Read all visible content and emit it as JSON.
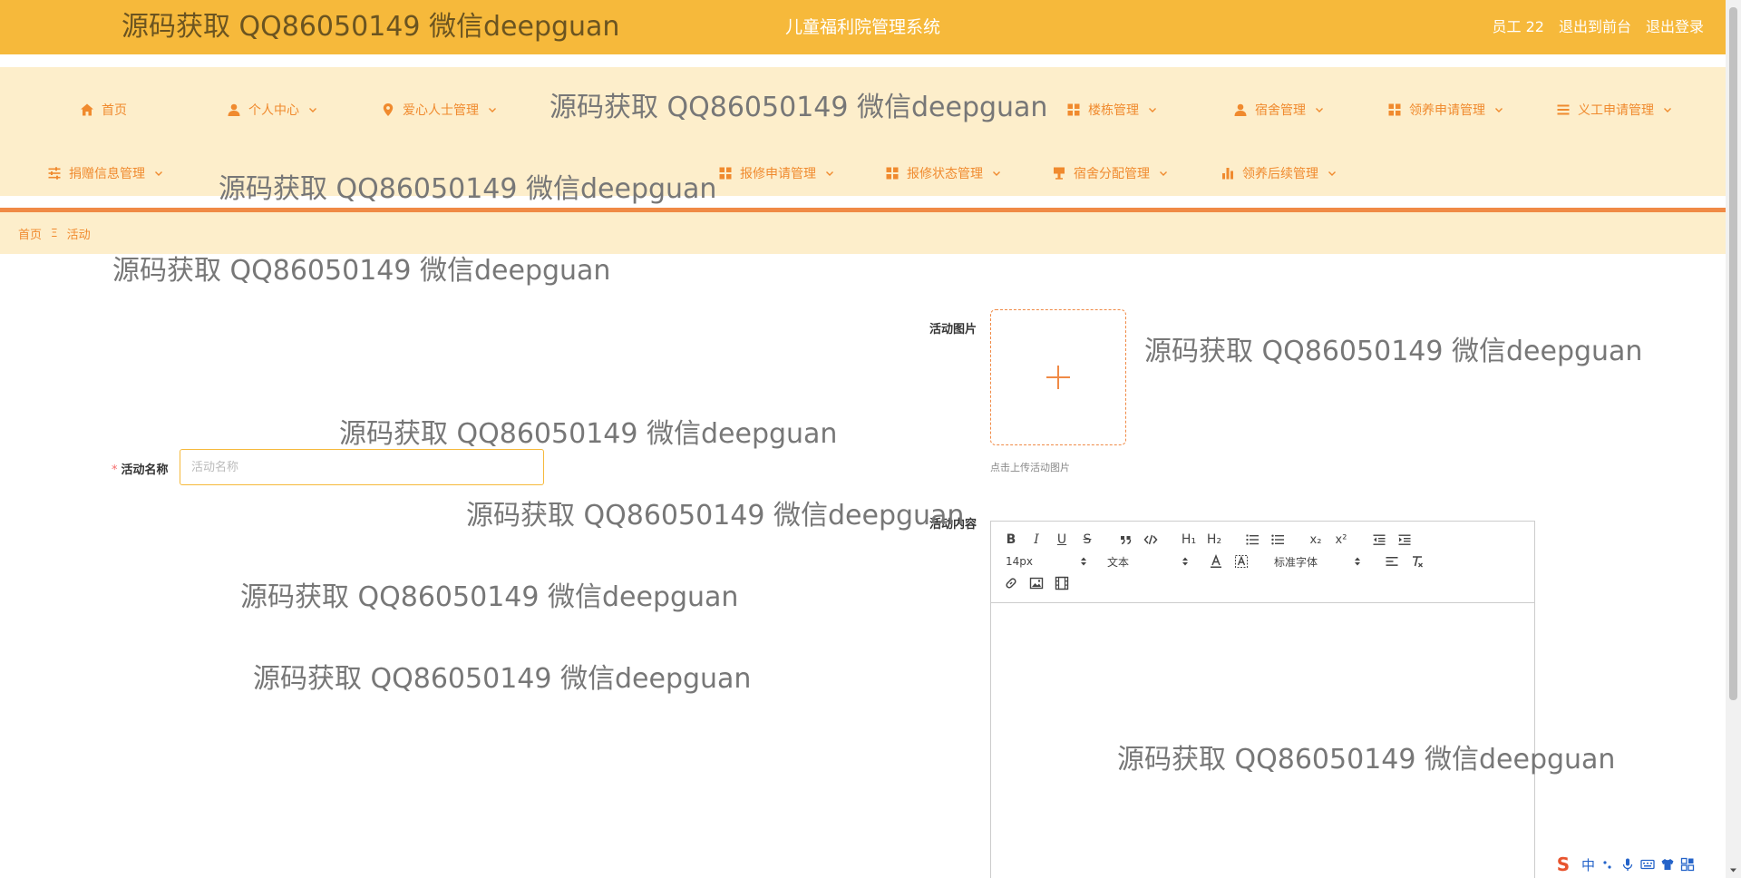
{
  "header": {
    "title": "儿童福利院管理系统",
    "user_role": "员工",
    "user_name": "22",
    "to_front_label": "退出到前台",
    "logout_label": "退出登录"
  },
  "nav": {
    "row1": [
      {
        "label": "首页",
        "icon": "home-icon",
        "has_submenu": false
      },
      {
        "label": "个人中心",
        "icon": "user-icon",
        "has_submenu": true
      },
      {
        "label": "爱心人士管理",
        "icon": "location-icon",
        "has_submenu": true
      },
      {
        "label": "楼栋管理",
        "icon": "grid-icon",
        "has_submenu": true
      },
      {
        "label": "宿舍管理",
        "icon": "user-icon",
        "has_submenu": true
      },
      {
        "label": "领养申请管理",
        "icon": "grid-icon",
        "has_submenu": true
      },
      {
        "label": "义工申请管理",
        "icon": "list-icon",
        "has_submenu": true
      }
    ],
    "row2": [
      {
        "label": "捐赠信息管理",
        "icon": "sliders-icon",
        "has_submenu": true
      },
      {
        "label": "报修申请管理",
        "icon": "grid-icon",
        "has_submenu": true
      },
      {
        "label": "报修状态管理",
        "icon": "grid-icon",
        "has_submenu": true
      },
      {
        "label": "宿舍分配管理",
        "icon": "cup-icon",
        "has_submenu": true
      },
      {
        "label": "领养后续管理",
        "icon": "bar-chart-icon",
        "has_submenu": true
      }
    ]
  },
  "breadcrumb": {
    "home": "首页",
    "separator": "Ξ",
    "current": "活动"
  },
  "form": {
    "image_label": "活动图片",
    "upload_tip": "点击上传活动图片",
    "name_label": "活动名称",
    "name_placeholder": "活动名称",
    "name_value": "",
    "content_label": "活动内容"
  },
  "editor": {
    "font_size": "14px",
    "block_type": "文本",
    "font_family": "标准字体",
    "buttons": {
      "bold": "B",
      "italic": "I",
      "underline": "U",
      "strike": "S",
      "h1": "H₁",
      "h2": "H₂",
      "sub": "x₂",
      "sup": "x²"
    }
  },
  "ime": {
    "lang": "中"
  },
  "watermark": "源码获取 QQ86050149 微信deepguan",
  "colors": {
    "header_bg": "#f6b93b",
    "nav_bg": "#fdeecb",
    "accent": "#f08a2e",
    "divider": "#f08a46",
    "required": "#f56c6c"
  }
}
